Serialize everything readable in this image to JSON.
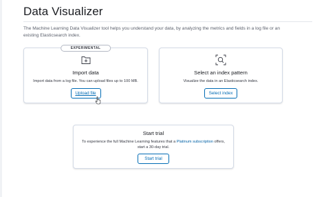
{
  "page": {
    "title": "Data Visualizer",
    "intro": "The Machine Learning Data Visualizer tool helps you understand your data, by analyzing the metrics and fields in a log file or an existing Elasticsearch index."
  },
  "import_card": {
    "badge": "EXPERIMENTAL",
    "icon": "file-import-icon",
    "title": "Import data",
    "description": "Import data from a log file. You can upload files up to 100 MB.",
    "button_label": "Upload file"
  },
  "index_card": {
    "icon": "index-pattern-icon",
    "title": "Select an index pattern",
    "description": "Visualize the data in an Elasticsearch index.",
    "button_label": "Select index"
  },
  "trial_card": {
    "title": "Start trial",
    "description_before": "To experience the full Machine Learning features that a ",
    "description_link": "Platinum subscription",
    "description_after": " offers, start a 30-day trial.",
    "button_label": "Start trial"
  },
  "colors": {
    "primary": "#006bb4",
    "link": "#0061a6",
    "border": "#d3dae6",
    "text": "#343741"
  }
}
